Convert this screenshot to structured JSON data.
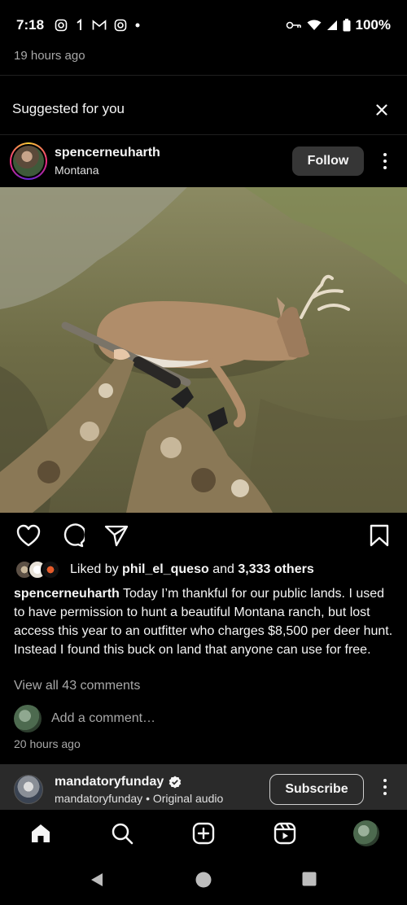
{
  "status_bar": {
    "time": "7:18",
    "battery": "100%",
    "icons": [
      "instagram-icon",
      "notification-icon",
      "gmail-icon",
      "instagram-icon",
      "dot-icon",
      "vpn-key-icon",
      "wifi-icon",
      "signal-icon",
      "battery-icon"
    ]
  },
  "previous_post": {
    "timestamp": "19 hours ago"
  },
  "suggested": {
    "heading": "Suggested for you"
  },
  "post": {
    "username": "spencerneuharth",
    "location": "Montana",
    "follow_label": "Follow",
    "likes": {
      "prefix": "Liked by ",
      "liker": "phil_el_queso",
      "middle": " and ",
      "count": "3,333 others"
    },
    "caption_user": "spencerneuharth",
    "caption_text": " Today I’m thankful for our public lands. I used to have permission to hunt a beautiful Montana ranch, but lost access this year to an outfitter who charges $8,500 per deer hunt. Instead I found this buck on land that anyone can use for free.",
    "view_comments": "View all 43 comments",
    "add_comment_placeholder": "Add a comment…",
    "timestamp": "20 hours ago"
  },
  "audio_bar": {
    "username": "mandatoryfunday",
    "subtitle": "mandatoryfunday • Original audio",
    "subscribe_label": "Subscribe"
  },
  "colors": {
    "background": "#000000",
    "text": "#f5f5f5",
    "secondary_text": "#a8a8a8",
    "button_bg": "#363636",
    "audio_bar_bg": "#2a2a2a"
  }
}
